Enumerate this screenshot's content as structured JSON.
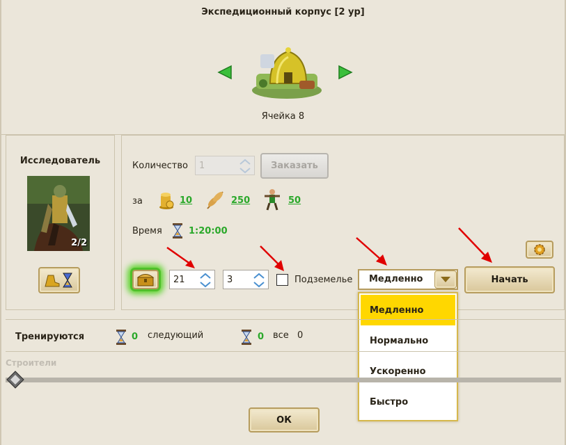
{
  "window": {
    "title": "Экспедиционный корпус [2 ур]"
  },
  "building": {
    "cell_label": "Ячейка 8"
  },
  "unit": {
    "name": "Исследователь",
    "count_badge": "2/2"
  },
  "order": {
    "quantity_label": "Количество",
    "quantity_value": "1",
    "order_button": "Заказать",
    "cost_label": "за",
    "costs": [
      {
        "icon": "gold-coins-icon",
        "value": "10"
      },
      {
        "icon": "wheat-icon",
        "value": "250"
      },
      {
        "icon": "worker-icon",
        "value": "50"
      }
    ],
    "time_label": "Время",
    "time_value": "1:20:00"
  },
  "expedition": {
    "field1_value": "21",
    "field2_value": "3",
    "dungeon_label": "Подземелье",
    "speed_selected": "Медленно",
    "speed_options": [
      "Медленно",
      "Нормально",
      "Ускоренно",
      "Быстро"
    ],
    "start_button": "Начать"
  },
  "training": {
    "label": "Тренируются",
    "next_count": "0",
    "next_label": "следующий",
    "all_count": "0",
    "all_label": "все",
    "all_value": "0"
  },
  "builders": {
    "label": "Строители"
  },
  "footer": {
    "ok_button": "ОК"
  },
  "colors": {
    "accent_green": "#2aa82a",
    "dropdown_selected": "#ffd700",
    "arrow_red": "#e00000"
  }
}
